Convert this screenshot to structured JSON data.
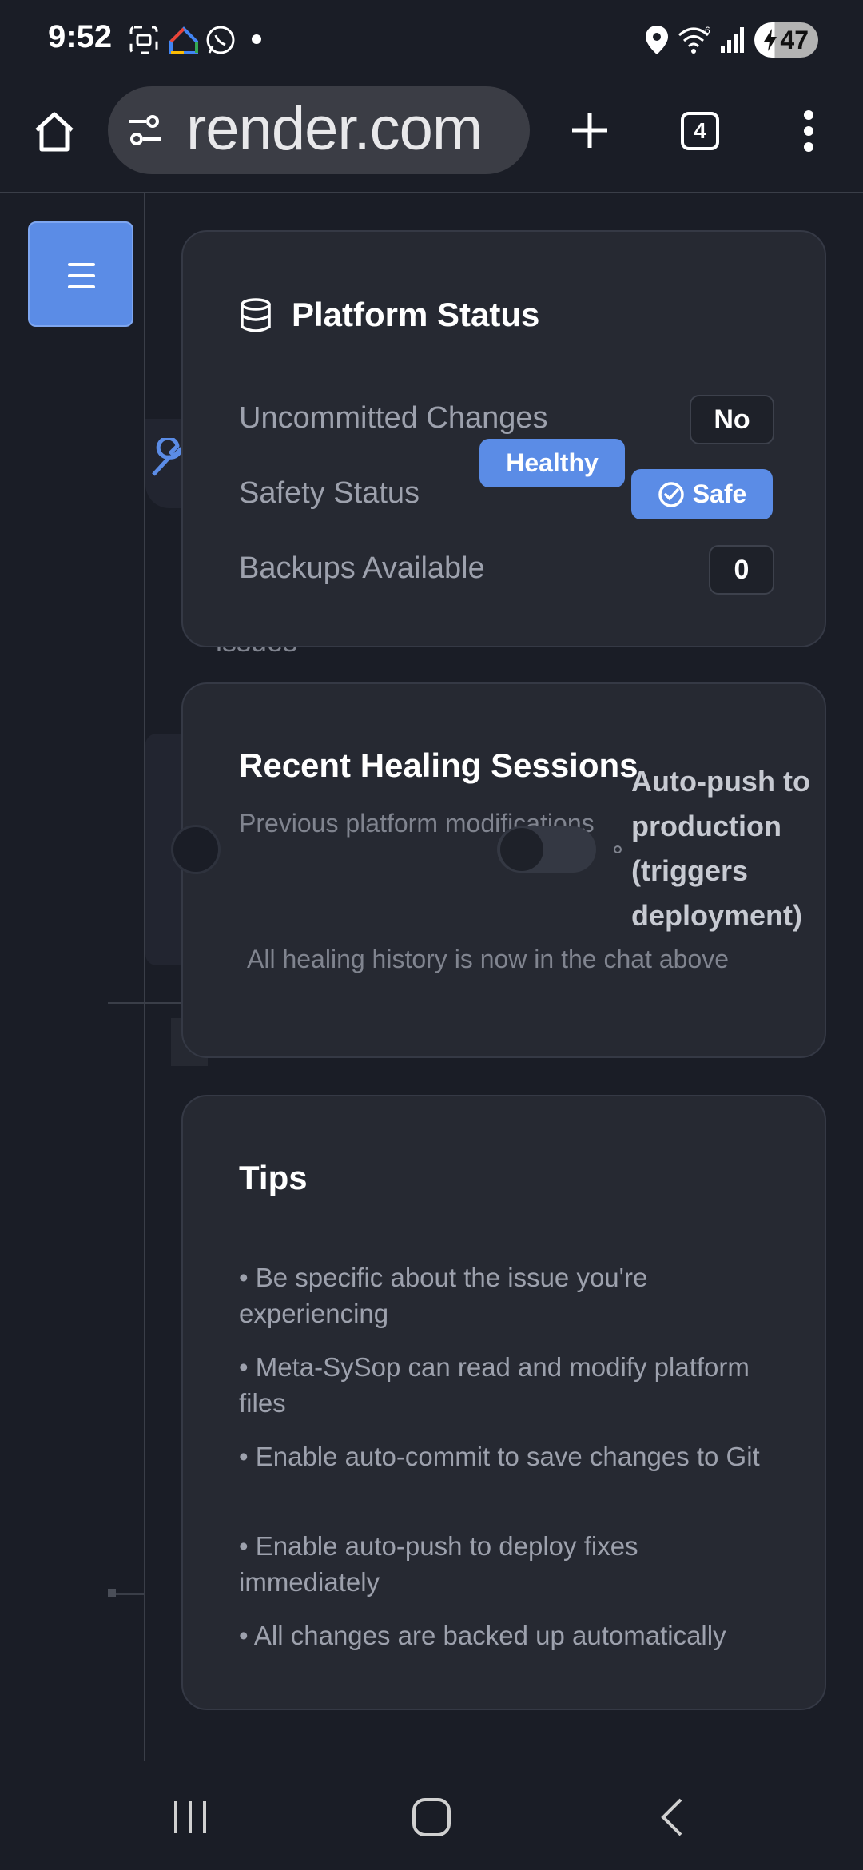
{
  "status_bar": {
    "time": "9:52",
    "battery": "47"
  },
  "browser": {
    "url": "render.com",
    "tab_count": "4"
  },
  "platform_status": {
    "title": "Platform Status",
    "rows": [
      {
        "label": "Uncommitted Changes",
        "value": "No"
      },
      {
        "label": "Safety Status",
        "value": "Safe"
      },
      {
        "label": "Backups Available",
        "value": "0"
      }
    ],
    "healthy_badge": "Healthy"
  },
  "background": {
    "issues_text": "issues",
    "auto_push_label": "Auto-push to production (triggers deployment)"
  },
  "healing_sessions": {
    "title": "Recent Healing Sessions",
    "subtitle": "Previous platform modifications",
    "empty_message": "All healing history is now in the chat above"
  },
  "tips": {
    "title": "Tips",
    "items": [
      "• Be specific about the issue you're experiencing",
      "• Meta-SySop can read and modify platform files",
      "• Enable auto-commit to save changes to Git",
      "• Enable auto-push to deploy fixes immediately",
      "• All changes are backed up automatically"
    ]
  },
  "colors": {
    "accent": "#5b8ce6",
    "card": "#262932",
    "background": "#1a1d26"
  }
}
